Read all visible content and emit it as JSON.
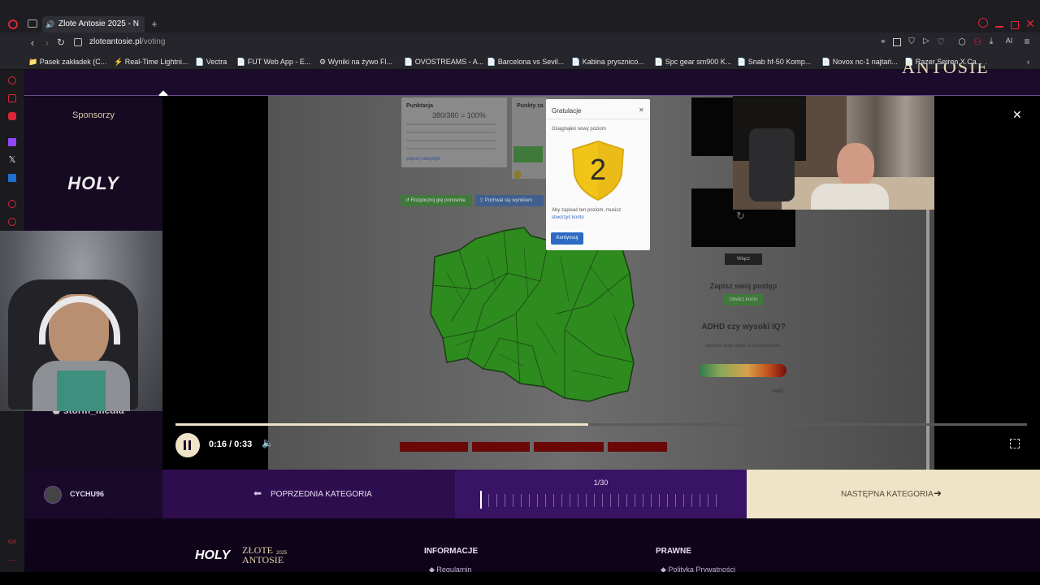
{
  "browser": {
    "tab_title": "Zlote Antosie 2025 - N",
    "url_domain": "zloteantosie.pl",
    "url_path": "/voting",
    "bookmarks": [
      "Pasek zakładek (C...",
      "Real-Time Lightni...",
      "Vectra",
      "FUT Web App - E...",
      "Wyniki na żywo Fl...",
      "OVOSTREAMS - A...",
      "Barcelona vs Sevil...",
      "Kabina prysznico...",
      "Spc gear sm900 K...",
      "Snab hf-50 Komp...",
      "Novox nc-1 najtań...",
      "Razer Seiren X Ca..."
    ],
    "ai_label": "AI"
  },
  "page": {
    "sponsors_title": "Sponsorzy",
    "sponsor_logo": "HOLY",
    "sponsor_second": "storm_media",
    "user_name": "CYCHU96",
    "prev_label": "POPRZEDNIA KATEGORIA",
    "next_label": "NASTĘPNA KATEGORIA",
    "progress_label": "1/30",
    "footer_logo": "HOLY",
    "footer_title_1": "ZŁOTE",
    "footer_title_2": "ANTOSIE",
    "footer_year": "2025",
    "footer_heading_info": "INFORMACJE",
    "footer_heading_legal": "PRAWNE",
    "footer_link_info": "Regulamin",
    "footer_link_legal": "Polityka Prywatności",
    "header_logo_text": "ANTOSIE"
  },
  "video": {
    "time": "0:16 / 0:33",
    "progress": 0.485,
    "modal_title": "Gratulacje",
    "modal_subtitle": "Osiągnąłeś nowy poziom",
    "level": "2",
    "modal_text": "Aby zapisać ten poziom, musisz",
    "modal_link": "stworzyć konto",
    "modal_button": "Kontynuuj",
    "score_title": "Punktacja",
    "score_value": "380/380 = 100%",
    "score_link": "więcej statystyk",
    "points_title": "Punkty za",
    "btn_restart": "Rozpocznij grę ponownie",
    "btn_share": "Pochwal się wynikiem",
    "save_title": "Zapisz swój postęp",
    "save_button": "Utwórz konto",
    "side_button": "Włącz",
    "adhd_title": "ADHD czy wysoki IQ?",
    "adhd_text": "Sprawdź swoje wyniki na specjalnej skali",
    "adhd_footer": "myIQ"
  },
  "colors": {
    "accent": "#3a1464",
    "gold": "#efe4c8",
    "map_green": "#2e8b1e"
  }
}
